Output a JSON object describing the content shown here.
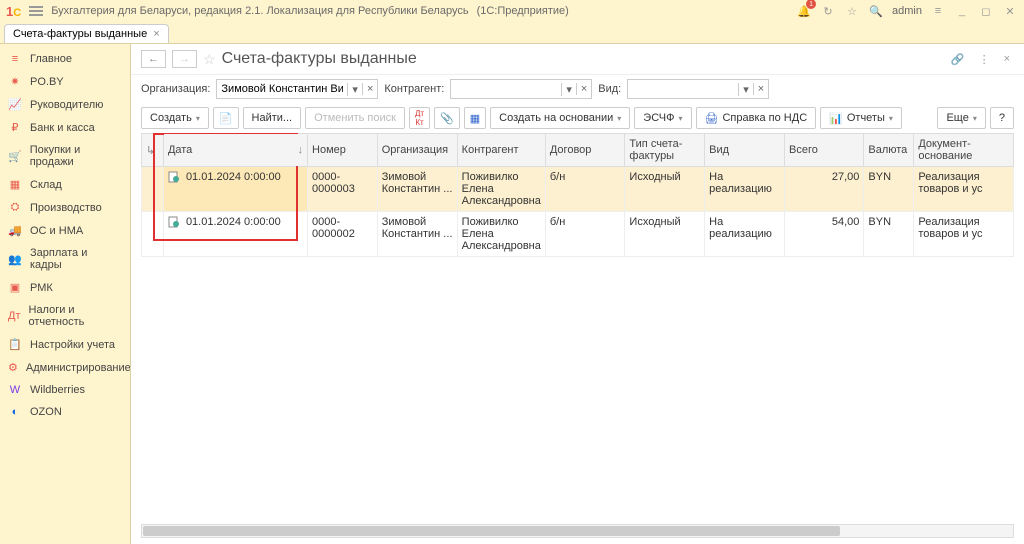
{
  "titlebar": {
    "app": "Бухгалтерия для Беларуси, редакция 2.1. Локализация для Республики Беларусь",
    "mode": "(1С:Предприятие)",
    "badge": "1",
    "user": "admin"
  },
  "tab": {
    "label": "Счета-фактуры выданные"
  },
  "sidebar": [
    {
      "label": "Главное",
      "icon": "≡"
    },
    {
      "label": "PO.BY",
      "icon": "✷"
    },
    {
      "label": "Руководителю",
      "icon": "📈"
    },
    {
      "label": "Банк и касса",
      "icon": "₽"
    },
    {
      "label": "Покупки и продажи",
      "icon": "🛒"
    },
    {
      "label": "Склад",
      "icon": "▦"
    },
    {
      "label": "Производство",
      "icon": "⛭"
    },
    {
      "label": "ОС и НМА",
      "icon": "🚚"
    },
    {
      "label": "Зарплата и кадры",
      "icon": "👥"
    },
    {
      "label": "РМК",
      "icon": "▣"
    },
    {
      "label": "Налоги и отчетность",
      "icon": "Дт"
    },
    {
      "label": "Настройки учета",
      "icon": "📋"
    },
    {
      "label": "Администрирование",
      "icon": "⚙"
    },
    {
      "label": "Wildberries",
      "icon": "W",
      "special": true
    },
    {
      "label": "OZON",
      "icon": "◐",
      "ozon": true
    }
  ],
  "page": {
    "title": "Счета-фактуры выданные"
  },
  "filters": {
    "org_label": "Организация:",
    "org_value": "Зимовой Константин Викто",
    "cp_label": "Контрагент:",
    "cp_value": "",
    "vid_label": "Вид:",
    "vid_value": ""
  },
  "toolbar": {
    "create": "Создать",
    "find": "Найти...",
    "cancel_find": "Отменить поиск",
    "create_based": "Создать на основании",
    "eschf": "ЭСЧФ",
    "spravka": "Справка по НДС",
    "reports": "Отчеты",
    "more": "Еще",
    "help": "?"
  },
  "columns": [
    "Дата",
    "Номер",
    "Организация",
    "Контрагент",
    "Договор",
    "Тип счета-фактуры",
    "Вид",
    "Всего",
    "Валюта",
    "Документ-основание"
  ],
  "rows": [
    {
      "date": "01.01.2024 0:00:00",
      "num": "0000-0000003",
      "org": "Зимовой Константин ...",
      "cp": "Поживилко Елена Александровна",
      "dog": "б/н",
      "tip": "Исходный",
      "vid": "На реализацию",
      "total": "27,00",
      "cur": "BYN",
      "doc": "Реализация товаров и ус",
      "hl": true
    },
    {
      "date": "01.01.2024 0:00:00",
      "num": "0000-0000002",
      "org": "Зимовой Константин ...",
      "cp": "Поживилко Елена Александровна",
      "dog": "б/н",
      "tip": "Исходный",
      "vid": "На реализацию",
      "total": "54,00",
      "cur": "BYN",
      "doc": "Реализация товаров и ус",
      "hl": false
    }
  ]
}
